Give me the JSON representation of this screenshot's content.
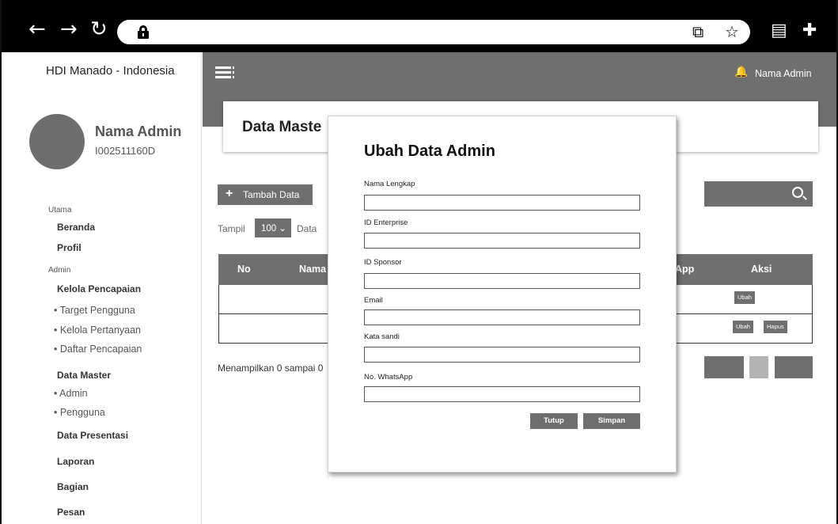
{
  "browser": {
    "back": "←",
    "forward": "→",
    "reload": "↻",
    "open_external": "⧉",
    "bookmark": "☆",
    "reader": "▤",
    "extensions": "✚"
  },
  "sidebar": {
    "site_title": "HDI Manado - Indonesia",
    "profile": {
      "name": "Nama Admin",
      "id": "I002511160D"
    },
    "sections": {
      "main": "Utama",
      "admin": "Admin"
    },
    "items": {
      "beranda": "Beranda",
      "profil": "Profil",
      "kelola_pencapaian": "Kelola Pencapaian",
      "target_pengguna": "• Target Pengguna",
      "kelola_pertanyaan": "• Kelola Pertanyaan",
      "daftar_pencapaian": "• Daftar Pencapaian",
      "data_master": "Data Master",
      "admin": "• Admin",
      "pengguna": "• Pengguna",
      "data_presentasi": "Data Presentasi",
      "laporan": "Laporan",
      "bagian": "Bagian",
      "pesan": "Pesan"
    }
  },
  "header": {
    "user_name": "Nama Admin"
  },
  "main": {
    "page_title": "Data Maste",
    "add_button": "Tambah Data",
    "show_label": "Tampil",
    "show_value": "100 ⌄",
    "data_label": "Data",
    "table": {
      "headers": {
        "no": "No",
        "name": "Nama",
        "app": "App",
        "action": "Aksi"
      },
      "row1": {
        "edit": "Ubah"
      },
      "row2": {
        "edit": "Ubah",
        "delete": "Hapus"
      }
    },
    "footer_text": "Menampilkan 0 sampai 0"
  },
  "modal": {
    "title": "Ubah Data Admin",
    "fields": {
      "full_name": {
        "label": "Nama Lengkap",
        "value": ""
      },
      "enterprise_id": {
        "label": "ID Enterprise",
        "value": ""
      },
      "sponsor_id": {
        "label": "ID Sponsor",
        "value": ""
      },
      "email": {
        "label": "Email",
        "value": ""
      },
      "password": {
        "label": "Kata sandi",
        "value": ""
      },
      "whatsapp": {
        "label": "No. WhatsApp",
        "value": ""
      }
    },
    "close_button": "Tutup",
    "save_button": "Simpan"
  },
  "colors": {
    "primary_gray": "#6f6f6f",
    "browser_bar": "#000000"
  }
}
